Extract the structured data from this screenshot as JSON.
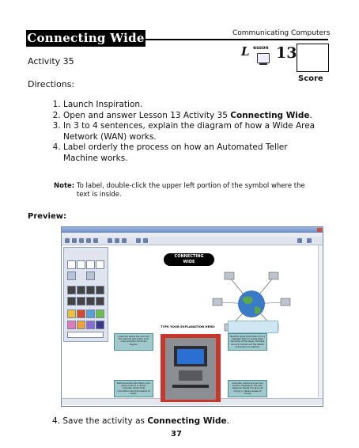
{
  "header": {
    "title": "Connecting Wide",
    "series": "Communicating Computers",
    "lesson_prefix": "L",
    "lesson_small": "esson",
    "lesson_number": "13",
    "score_label": "Score"
  },
  "activity_label": "Activity 35",
  "directions_label": "Directions:",
  "steps": [
    {
      "text": "Launch Inspiration."
    },
    {
      "text": "Open and answer Lesson 13 Activity 35 ",
      "bold": "Connecting Wide",
      "after": "."
    },
    {
      "text": "In 3 to 4 sentences, explain the diagram of how a Wide Area Network (WAN) works."
    },
    {
      "text": "Label orderly the process on how an Automated Teller Machine works."
    }
  ],
  "note": {
    "label": "Note:",
    "text": "To label, double-click the upper left portion of the symbol where the text is inside."
  },
  "preview_label": "Preview:",
  "preview": {
    "diagram_title_line1": "CONNECTING",
    "diagram_title_line2": "WIDE",
    "caption": "TYPE YOUR EXPLANATION HERE:",
    "tiles": [
      "Customer places the card into the machine and enters a pin code using the machine's keypad.",
      "Machine reads information from a magnetic strip on card & gives the name of the owner, the bank account number and the details of policies it is linked to.",
      "Machine sends information over phone lines to a central computer which holds information about thousands of banks.",
      "Computer checks account and sends a message to the cash dispenser telling it to give out money or refuse release of money."
    ],
    "colors": {
      "tile": "#9fc9cc",
      "atm_frame": "#c8372a",
      "input_box": "#cfe7f3"
    }
  },
  "final_step": {
    "number": "4.",
    "text": "Save the activity as ",
    "bold": "Connecting Wide",
    "after": "."
  },
  "page_number": "37"
}
